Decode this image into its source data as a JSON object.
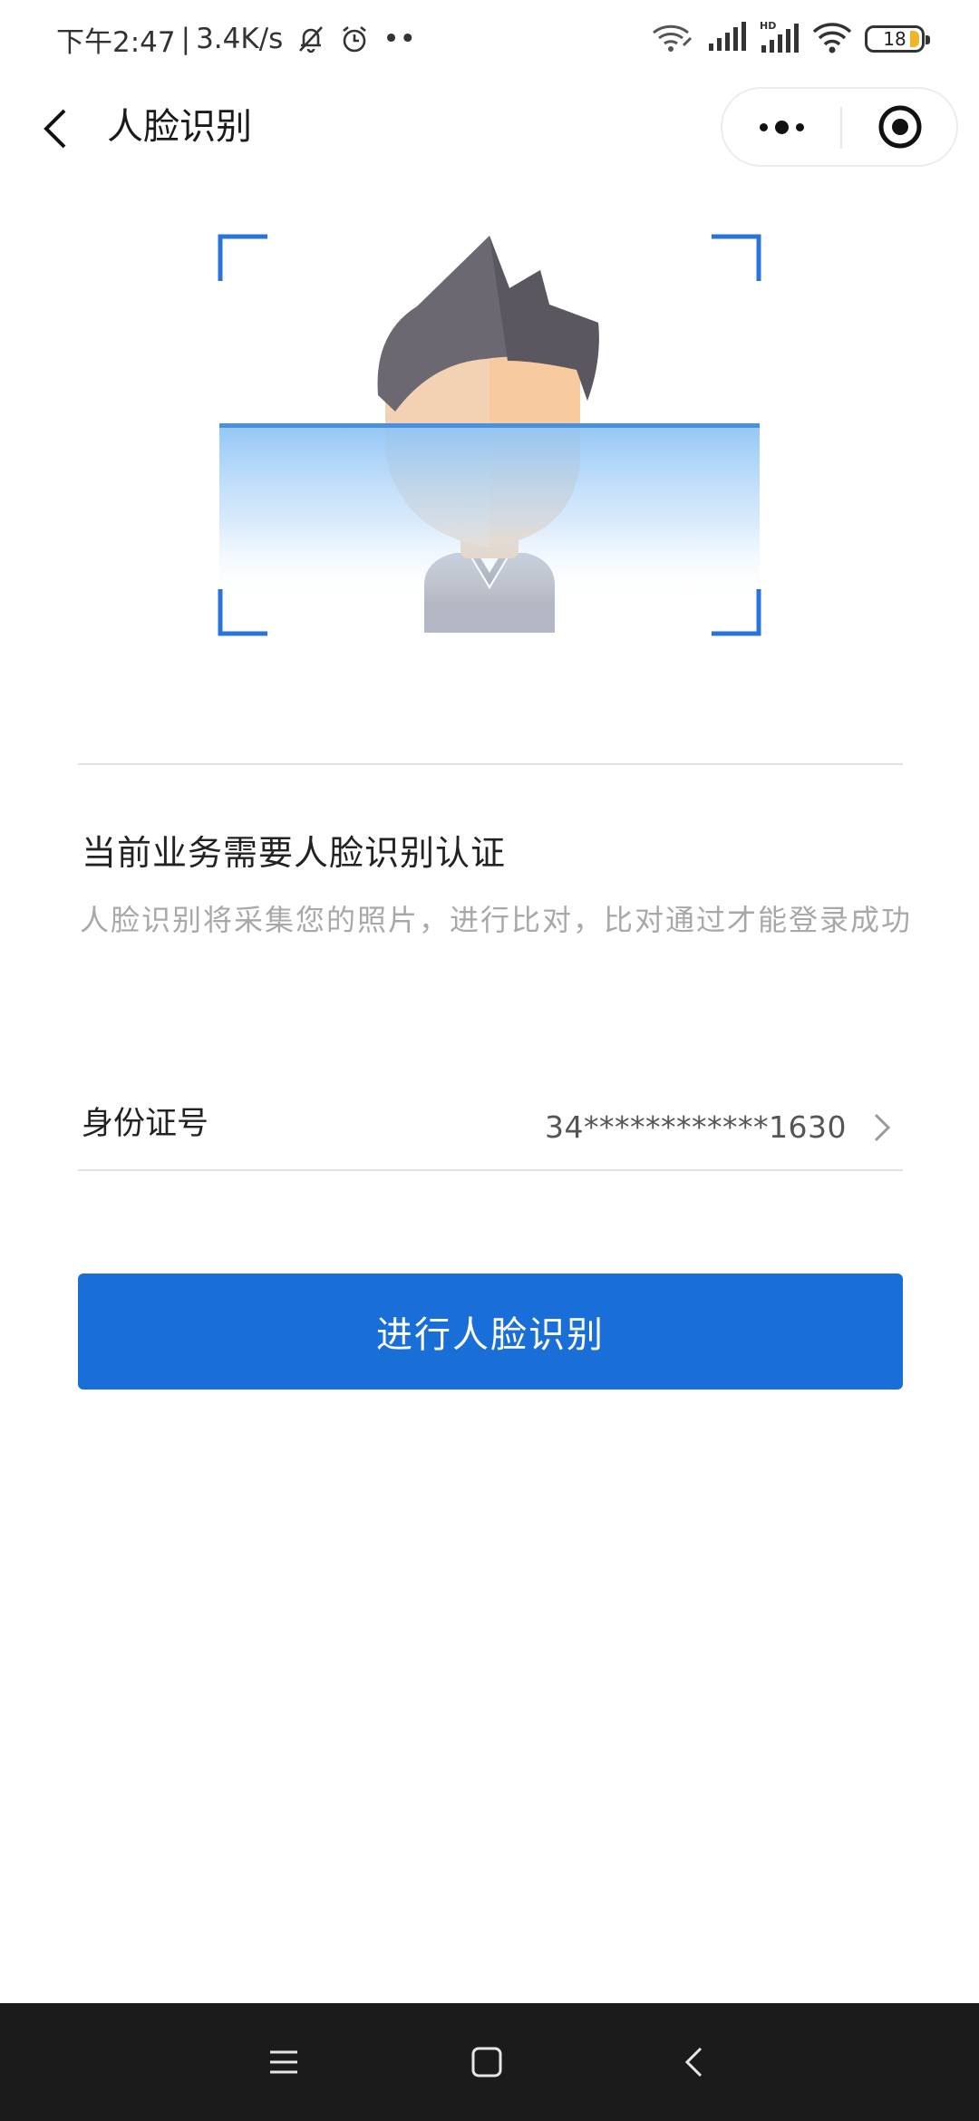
{
  "status_bar": {
    "time": "下午2:47",
    "separator": "|",
    "net_speed": "3.4K/s",
    "more_dots": "••",
    "battery_level": "18"
  },
  "nav": {
    "title": "人脸识别"
  },
  "content": {
    "headline": "当前业务需要人脸识别认证",
    "description": "人脸识别将采集您的照片，进行比对，比对通过才能登录成功",
    "id_label": "身份证号",
    "id_value": "34************1630",
    "primary_button": "进行人脸识别"
  },
  "colors": {
    "accent": "#1a6ed8",
    "frame_corner": "#2a73d9",
    "battery_fill": "#f0b429"
  }
}
